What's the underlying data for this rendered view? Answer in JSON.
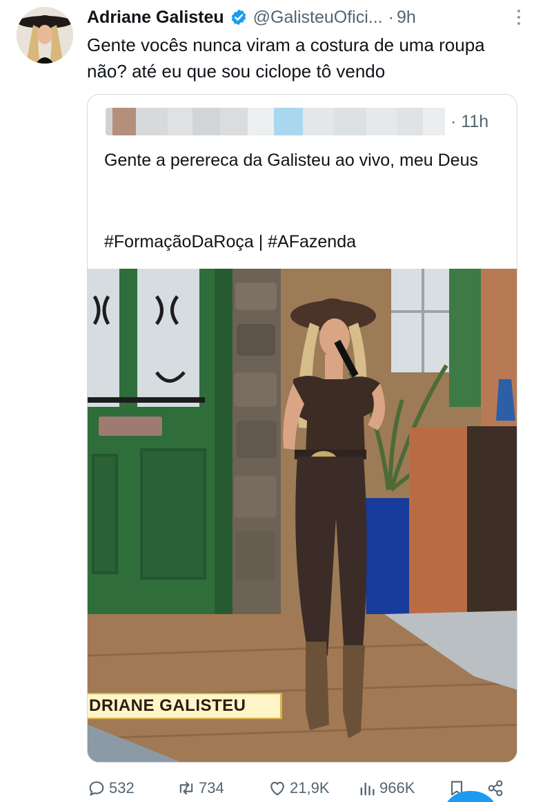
{
  "author": {
    "name": "Adriane Galisteu",
    "handle": "@GalisteuOfici...",
    "separator": "·",
    "time": "9h",
    "verified": true,
    "avatar_icon": "avatar-photo"
  },
  "tweet": {
    "text": "Gente vocês nunca viram a costura de uma roupa não? até eu que sou ciclope tô vendo"
  },
  "quoted": {
    "author_hidden": true,
    "time": "· 11h",
    "text": "Gente a perereca da Galisteu ao vivo, meu Deus",
    "hashtags": "#FormaçãoDaRoça | #AFazenda",
    "media": {
      "lower_third": "DRIANE GALISTEU"
    }
  },
  "actions": {
    "reply_count": "532",
    "retweet_count": "734",
    "like_count": "21,9K",
    "view_count": "966K"
  },
  "colors": {
    "text": "#0f1419",
    "secondary": "#536471",
    "verified": "#1d9bf0",
    "border": "#cfd9de"
  }
}
